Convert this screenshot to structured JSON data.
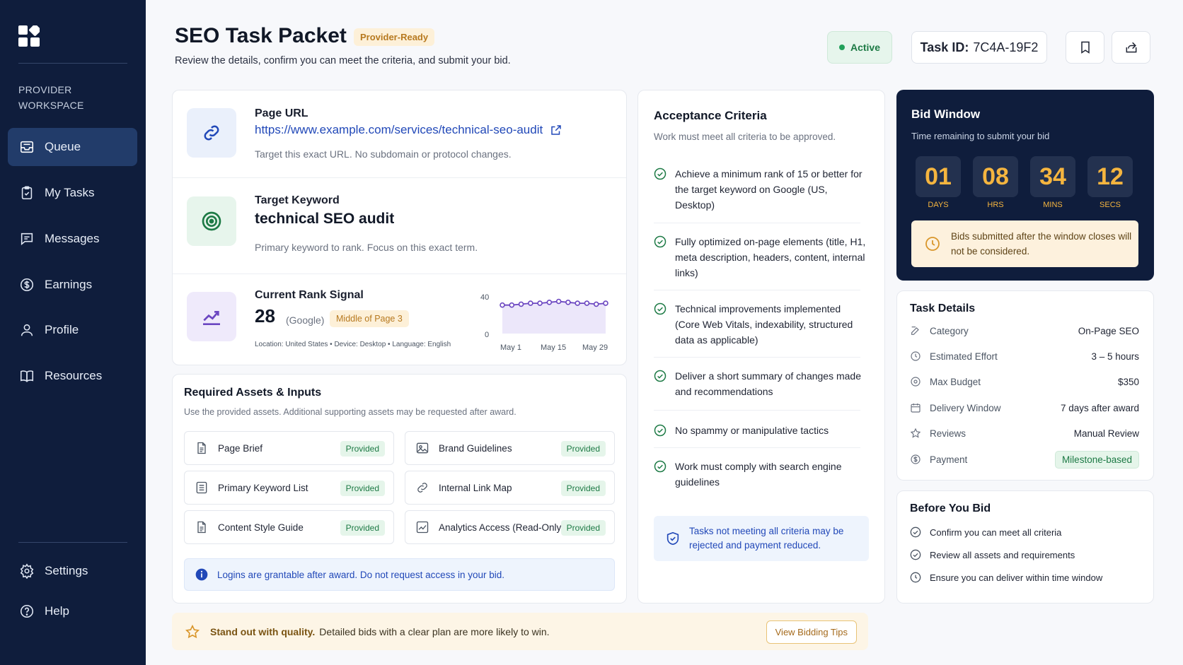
{
  "sidebar": {
    "workspace_line1": "PROVIDER",
    "workspace_line2": "WORKSPACE",
    "items": [
      {
        "label": "Queue",
        "icon": "inbox-icon"
      },
      {
        "label": "My Tasks",
        "icon": "clipboard-check-icon"
      },
      {
        "label": "Messages",
        "icon": "message-icon"
      },
      {
        "label": "Earnings",
        "icon": "dollar-icon"
      },
      {
        "label": "Profile",
        "icon": "user-icon"
      },
      {
        "label": "Resources",
        "icon": "book-icon"
      }
    ],
    "bottom": [
      {
        "label": "Settings",
        "icon": "gear-icon"
      },
      {
        "label": "Help",
        "icon": "help-icon"
      }
    ]
  },
  "header": {
    "title": "SEO Task Packet",
    "badge": "Provider-Ready",
    "subtitle": "Review the details, confirm you can meet the criteria, and submit your bid.",
    "status": "Active",
    "task_id_label": "Task ID:",
    "task_id": "7C4A-19F2"
  },
  "page_url": {
    "label": "Page URL",
    "url": "https://www.example.com/services/technical-seo-audit",
    "hint": "Target this exact URL. No subdomain or protocol changes."
  },
  "keyword": {
    "label": "Target Keyword",
    "value": "technical SEO audit",
    "hint": "Primary keyword to rank. Focus on this exact term."
  },
  "rank": {
    "label": "Current Rank Signal",
    "value": "28",
    "engine": "(Google)",
    "badge": "Middle of Page 3",
    "location_meta": "Location: United States  •  Device: Desktop  •  Language: English"
  },
  "chart_data": {
    "type": "line",
    "x_tick_labels": [
      "May 1",
      "May 15",
      "May 29"
    ],
    "y_tick_labels": [
      "40",
      "0"
    ],
    "ylim": [
      0,
      40
    ],
    "values": [
      31,
      31,
      32,
      33,
      33,
      34,
      35,
      34,
      33,
      33,
      32,
      33
    ],
    "color": "#6b46c1"
  },
  "assets": {
    "title": "Required Assets & Inputs",
    "subtitle": "Use the provided assets. Additional supporting assets may be requested after award.",
    "items": [
      {
        "name": "Page Brief",
        "status": "Provided",
        "icon": "document-icon"
      },
      {
        "name": "Brand Guidelines",
        "status": "Provided",
        "icon": "image-icon"
      },
      {
        "name": "Primary Keyword List",
        "status": "Provided",
        "icon": "list-icon"
      },
      {
        "name": "Internal Link Map",
        "status": "Provided",
        "icon": "link-icon"
      },
      {
        "name": "Content Style Guide",
        "status": "Provided",
        "icon": "document-icon"
      },
      {
        "name": "Analytics Access (Read-Only)",
        "status": "Provided",
        "icon": "chart-icon"
      }
    ],
    "note": "Logins are grantable after award. Do not request access in your bid."
  },
  "criteria": {
    "title": "Acceptance Criteria",
    "subtitle": "Work must meet all criteria to be approved.",
    "items": [
      "Achieve a minimum rank of 15 or better for the target keyword on Google (US, Desktop)",
      "Fully optimized on-page elements (title, H1, meta description, headers, content, internal links)",
      "Technical improvements implemented (Core Web Vitals, indexability, structured data as applicable)",
      "Deliver a short summary of changes made and recommendations",
      "No spammy or manipulative tactics",
      "Work must comply with search engine guidelines"
    ],
    "note": "Tasks not meeting all criteria may be rejected and payment reduced."
  },
  "bid_window": {
    "title": "Bid Window",
    "subtitle": "Time remaining to submit your bid",
    "countdown": [
      {
        "value": "01",
        "unit": "DAYS"
      },
      {
        "value": "08",
        "unit": "HRS"
      },
      {
        "value": "34",
        "unit": "MINS"
      },
      {
        "value": "12",
        "unit": "SECS"
      }
    ],
    "warning": "Bids submitted after the window closes will not be considered."
  },
  "details": {
    "title": "Task Details",
    "rows": [
      {
        "key": "Category",
        "value": "On-Page SEO",
        "icon": "edit-icon"
      },
      {
        "key": "Estimated Effort",
        "value": "3 – 5 hours",
        "icon": "clock-icon"
      },
      {
        "key": "Max Budget",
        "value": "$350",
        "icon": "target-icon"
      },
      {
        "key": "Delivery Window",
        "value": "7 days after award",
        "icon": "calendar-icon"
      },
      {
        "key": "Reviews",
        "value": "Manual Review",
        "icon": "star-icon"
      },
      {
        "key": "Payment",
        "value": "Milestone-based",
        "icon": "dollar-icon"
      }
    ]
  },
  "before": {
    "title": "Before You Bid",
    "items": [
      {
        "text": "Confirm you can meet all criteria",
        "icon": "check-circle-icon"
      },
      {
        "text": "Review all assets and requirements",
        "icon": "check-circle-icon"
      },
      {
        "text": "Ensure you can deliver within time window",
        "icon": "clock-icon"
      }
    ]
  },
  "footer": {
    "bold": "Stand out with quality.",
    "text": "Detailed bids with a clear plan are more likely to win.",
    "button": "View Bidding Tips"
  },
  "colors": {
    "sidebar": "#0f1d3c",
    "accent_blue": "#2148b8",
    "success": "#1d7a45",
    "warning": "#b7791f",
    "countdown": "#f5b53f"
  }
}
